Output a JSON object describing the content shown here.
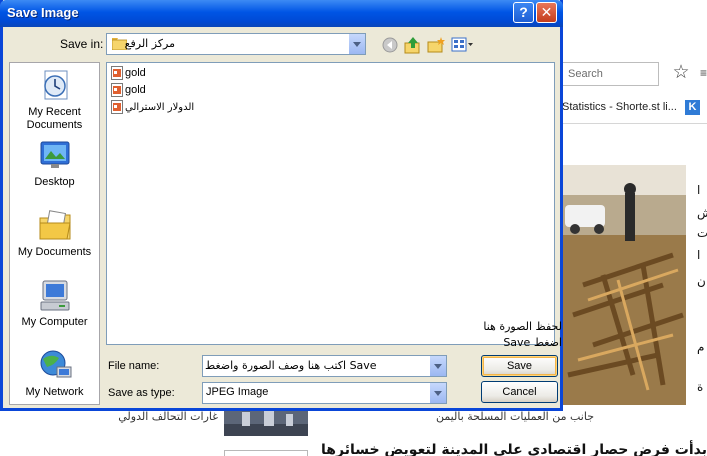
{
  "dialog": {
    "title": "Save Image",
    "save_in_label": "Save in:",
    "save_in_value": "مركز الرفع",
    "files": [
      {
        "name": "gold",
        "rtl": false
      },
      {
        "name": "gold",
        "rtl": false
      },
      {
        "name": "الدولار الاسترالي",
        "rtl": true
      }
    ],
    "places": [
      {
        "label": "My Recent Documents",
        "icon": "recent-documents-icon"
      },
      {
        "label": "Desktop",
        "icon": "desktop-icon"
      },
      {
        "label": "My Documents",
        "icon": "my-documents-icon"
      },
      {
        "label": "My Computer",
        "icon": "my-computer-icon"
      },
      {
        "label": "My Network",
        "icon": "my-network-icon"
      }
    ],
    "file_name_label": "File name:",
    "file_name_value": "اكتب هنا وصف الصورة واضغط Save",
    "save_as_type_label": "Save as type:",
    "save_as_type_value": "JPEG Image",
    "save_button": "Save",
    "cancel_button": "Cancel"
  },
  "annotation": {
    "line1": "لحفظ الصورة هنا",
    "line2": "اضغط Save"
  },
  "browser": {
    "search_placeholder": "Search",
    "bookmark_text": "Statistics - Shorte.st li...",
    "bookmark_icon_letter": "K"
  },
  "article": {
    "caption": "جانب من العمليات المسلحة باليمن",
    "related_link": "غارات التحالف الدولي",
    "body_fragment": "بدأت فرض حصار اقتصادي على المدينة لتعويض خسائرها"
  },
  "colors": {
    "titlebar": "#0055e5",
    "dialog_bg": "#ece9d8",
    "close_button": "#c43d1d"
  }
}
